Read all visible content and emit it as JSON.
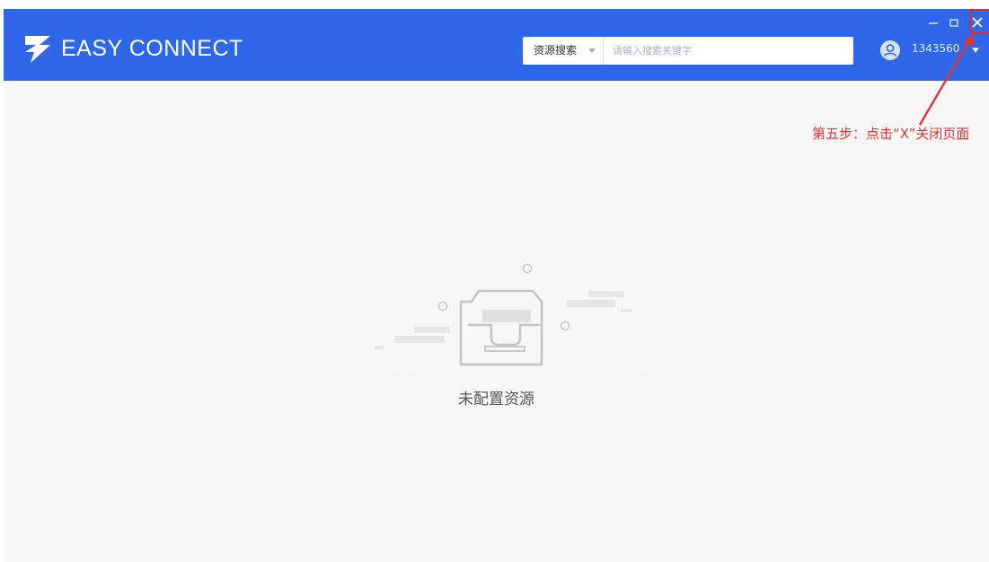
{
  "window": {
    "app_title": "EASY CONNECT"
  },
  "header": {
    "search": {
      "type_label": "资源搜索",
      "placeholder": "请输入搜索关键字"
    },
    "user": {
      "name": "1343560"
    }
  },
  "main": {
    "empty_text": "未配置资源"
  },
  "annotation": {
    "text": "第五步：点击“X”关闭页面"
  },
  "colors": {
    "header_bg": "#2e67e8",
    "annotation": "#e43232",
    "content_bg": "#f7f7f7"
  },
  "icons": [
    "logo-icon",
    "caret-down-icon",
    "user-avatar-icon",
    "minimize-icon",
    "maximize-icon",
    "close-icon",
    "empty-tray-icon"
  ]
}
